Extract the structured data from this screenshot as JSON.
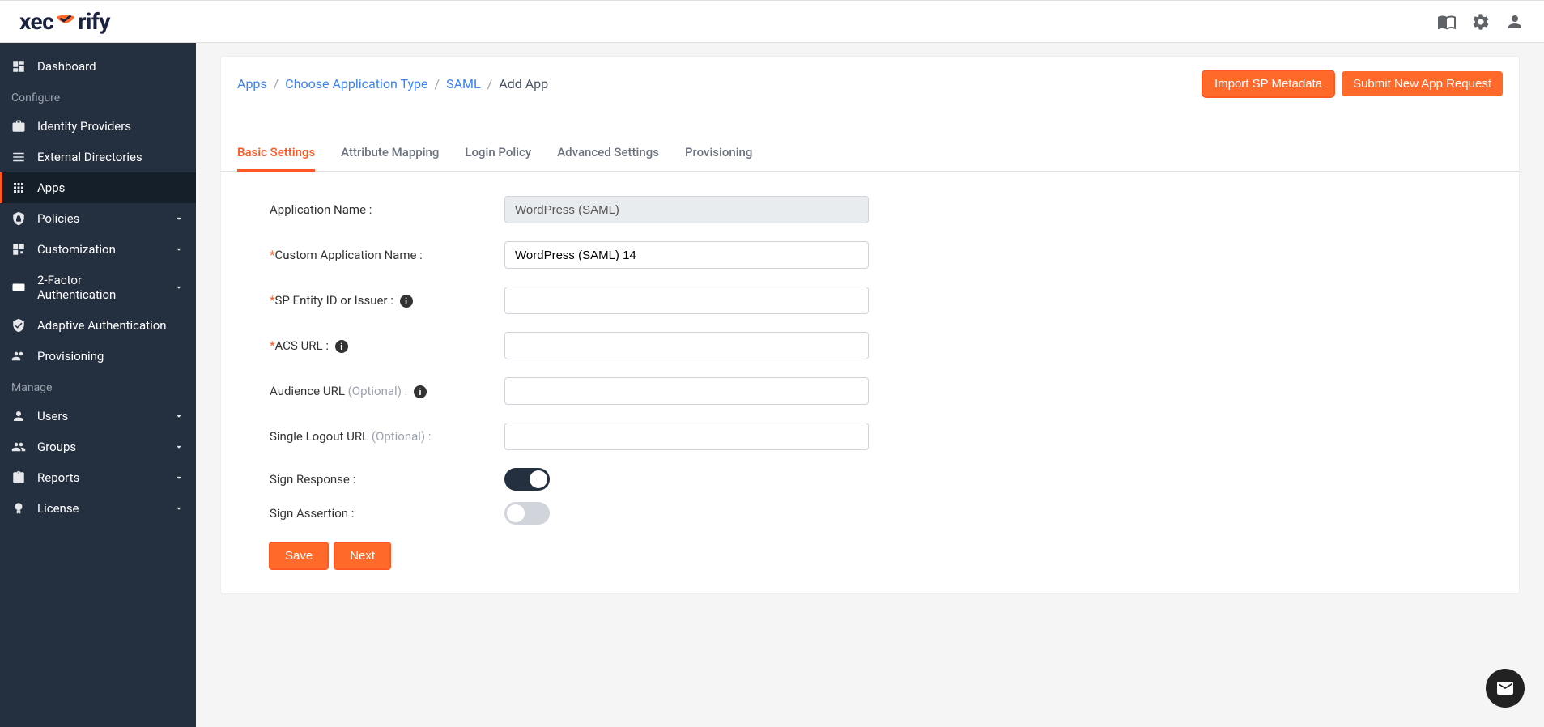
{
  "logo": {
    "prefix": "xec",
    "suffix": "rify"
  },
  "sidebar": {
    "configure_label": "Configure",
    "manage_label": "Manage",
    "dashboard": "Dashboard",
    "identity_providers": "Identity Providers",
    "external_directories": "External Directories",
    "apps": "Apps",
    "policies": "Policies",
    "customization": "Customization",
    "two_factor": "2-Factor Authentication",
    "adaptive_auth": "Adaptive Authentication",
    "provisioning": "Provisioning",
    "users": "Users",
    "groups": "Groups",
    "reports": "Reports",
    "license": "License"
  },
  "breadcrumb": {
    "apps": "Apps",
    "choose": "Choose Application Type",
    "saml": "SAML",
    "current": "Add App"
  },
  "buttons": {
    "import": "Import SP Metadata",
    "submit": "Submit New App Request",
    "save": "Save",
    "next": "Next"
  },
  "tabs": {
    "basic": "Basic Settings",
    "attribute": "Attribute Mapping",
    "login": "Login Policy",
    "advanced": "Advanced Settings",
    "provisioning": "Provisioning"
  },
  "form": {
    "app_name_label": "Application Name :",
    "app_name_value": "WordPress (SAML)",
    "custom_name_label": "Custom Application Name :",
    "custom_name_value": "WordPress (SAML) 14",
    "sp_entity_label": "SP Entity ID or Issuer :",
    "acs_url_label": "ACS URL :",
    "audience_url_label": "Audience URL ",
    "audience_optional": "(Optional) :",
    "slo_url_label": "Single Logout URL ",
    "slo_optional": "(Optional) :",
    "sign_response_label": "Sign Response :",
    "sign_assertion_label": "Sign Assertion :"
  }
}
